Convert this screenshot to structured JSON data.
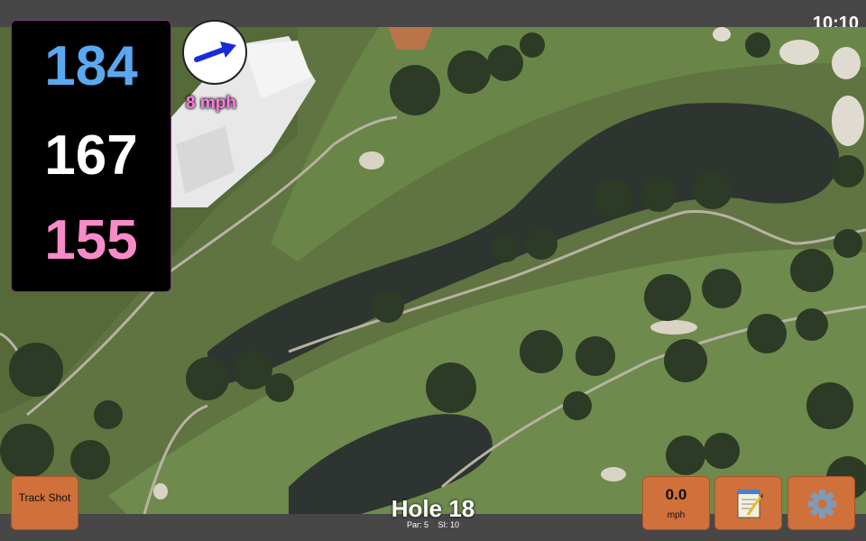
{
  "status": {
    "time": "10:10"
  },
  "distances": {
    "back": "184",
    "middle": "167",
    "front": "155"
  },
  "wind": {
    "speed_label": "8 mph"
  },
  "hole": {
    "title": "Hole 18",
    "par_label": "Par: 5",
    "si_label": "SI: 10"
  },
  "buttons": {
    "track_shot": "Track Shot",
    "speed_value": "0.0",
    "speed_unit": "mph",
    "notes_icon": "notepad-icon",
    "settings_icon": "gear-icon"
  },
  "colors": {
    "back": "#5aa8f0",
    "middle": "#ffffff",
    "front": "#f78ac8",
    "wind_text": "#ff7ae0",
    "button": "#d0703a"
  }
}
